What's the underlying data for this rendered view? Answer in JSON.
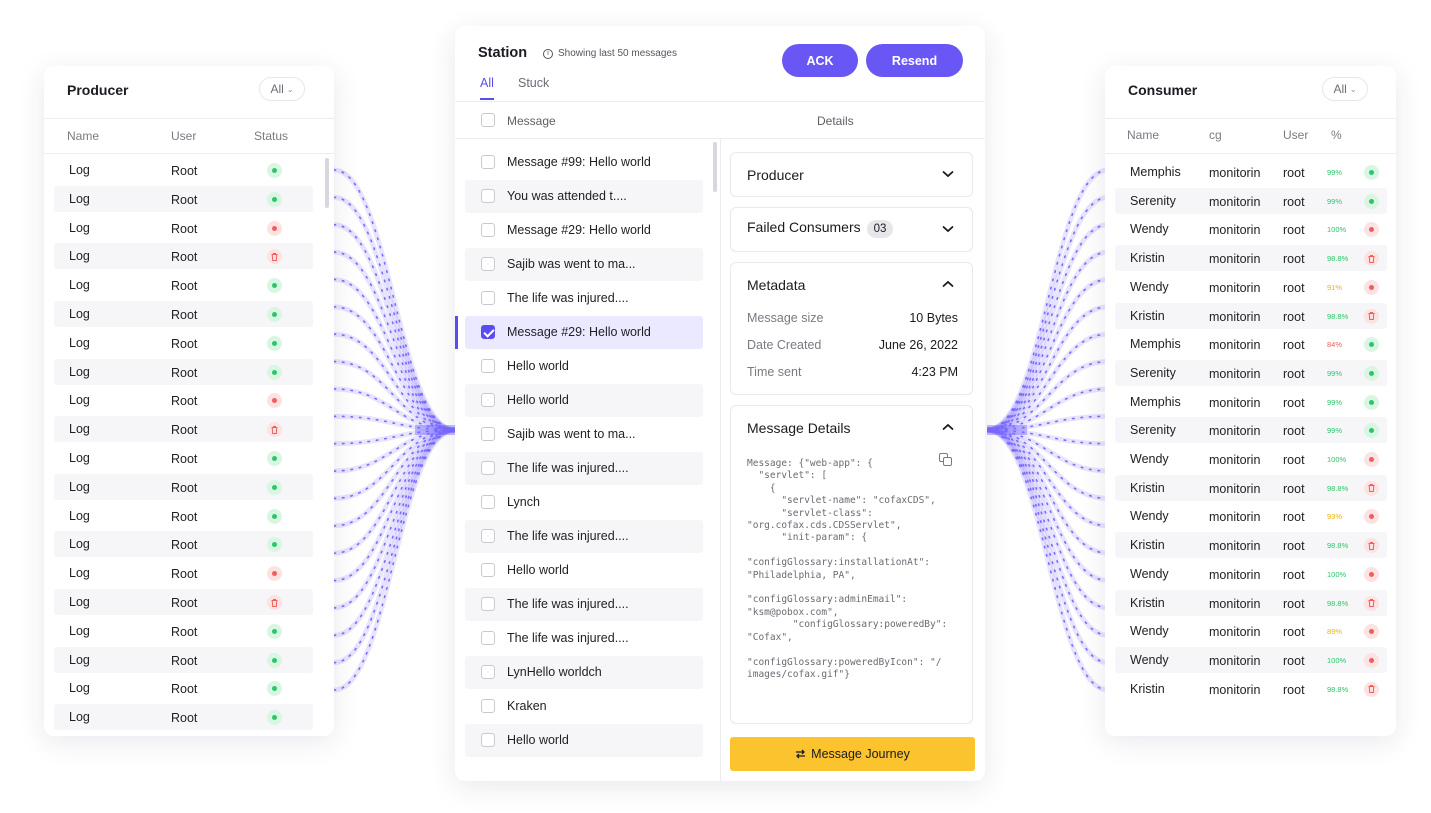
{
  "producer": {
    "title": "Producer",
    "filter": "All",
    "columns": [
      "Name",
      "User",
      "Status"
    ],
    "rows": [
      {
        "name": "Log",
        "user": "Root",
        "status": "ok"
      },
      {
        "name": "Log",
        "user": "Root",
        "status": "ok"
      },
      {
        "name": "Log",
        "user": "Root",
        "status": "error"
      },
      {
        "name": "Log",
        "user": "Root",
        "status": "deleted"
      },
      {
        "name": "Log",
        "user": "Root",
        "status": "ok"
      },
      {
        "name": "Log",
        "user": "Root",
        "status": "ok"
      },
      {
        "name": "Log",
        "user": "Root",
        "status": "ok"
      },
      {
        "name": "Log",
        "user": "Root",
        "status": "ok"
      },
      {
        "name": "Log",
        "user": "Root",
        "status": "error"
      },
      {
        "name": "Log",
        "user": "Root",
        "status": "deleted"
      },
      {
        "name": "Log",
        "user": "Root",
        "status": "ok"
      },
      {
        "name": "Log",
        "user": "Root",
        "status": "ok"
      },
      {
        "name": "Log",
        "user": "Root",
        "status": "ok"
      },
      {
        "name": "Log",
        "user": "Root",
        "status": "ok"
      },
      {
        "name": "Log",
        "user": "Root",
        "status": "error"
      },
      {
        "name": "Log",
        "user": "Root",
        "status": "deleted"
      },
      {
        "name": "Log",
        "user": "Root",
        "status": "ok"
      },
      {
        "name": "Log",
        "user": "Root",
        "status": "ok"
      },
      {
        "name": "Log",
        "user": "Root",
        "status": "ok"
      },
      {
        "name": "Log",
        "user": "Root",
        "status": "ok"
      }
    ]
  },
  "station": {
    "title": "Station",
    "info": "Showing last 50 messages",
    "ack_label": "ACK",
    "resend_label": "Resend",
    "tabs": [
      "All",
      "Stuck"
    ],
    "active_tab": "All",
    "col_message": "Message",
    "col_details": "Details",
    "messages": [
      {
        "text": "Message #99: Hello world",
        "selected": false
      },
      {
        "text": "You was attended t....",
        "selected": false
      },
      {
        "text": "Message #29: Hello world",
        "selected": false
      },
      {
        "text": "Sajib was went to ma...",
        "selected": false
      },
      {
        "text": "The life was injured....",
        "selected": false
      },
      {
        "text": "Message #29: Hello world",
        "selected": true
      },
      {
        "text": "Hello world",
        "selected": false
      },
      {
        "text": "Hello world",
        "selected": false
      },
      {
        "text": "Sajib was went to ma...",
        "selected": false
      },
      {
        "text": "The life was injured....",
        "selected": false
      },
      {
        "text": "Lynch",
        "selected": false
      },
      {
        "text": "The life was injured....",
        "selected": false
      },
      {
        "text": "Hello world",
        "selected": false
      },
      {
        "text": "The life was injured....",
        "selected": false
      },
      {
        "text": "The life was injured....",
        "selected": false
      },
      {
        "text": "LynHello worldch",
        "selected": false
      },
      {
        "text": "Kraken",
        "selected": false
      },
      {
        "text": "Hello world",
        "selected": false
      }
    ],
    "details": {
      "producer_label": "Producer",
      "failed_label": "Failed Consumers",
      "failed_count": "03",
      "metadata_label": "Metadata",
      "metadata": [
        {
          "key": "Message size",
          "value": "10 Bytes"
        },
        {
          "key": "Date Created",
          "value": "June 26, 2022"
        },
        {
          "key": "Time sent",
          "value": "4:23 PM"
        }
      ],
      "message_details_label": "Message Details",
      "code": "Message: {\"web-app\": {\n  \"servlet\": [\n    {\n      \"servlet-name\": \"cofaxCDS\",\n      \"servlet-class\":\n\"org.cofax.cds.CDSServlet\",\n      \"init-param\": {\n\n\"configGlossary:installationAt\":\n\"Philadelphia, PA\",\n\n\"configGlossary:adminEmail\":\n\"ksm@pobox.com\",\n        \"configGlossary:poweredBy\":\n\"Cofax\",\n\n\"configGlossary:poweredByIcon\": \"/\nimages/cofax.gif\"}"
    },
    "journey_label": "Message Journey"
  },
  "consumer": {
    "title": "Consumer",
    "filter": "All",
    "columns": [
      "Name",
      "cg",
      "User",
      "%"
    ],
    "rows": [
      {
        "name": "Memphis",
        "cg": "monitorin",
        "user": "root",
        "pct": "99%",
        "status": "ok"
      },
      {
        "name": "Serenity",
        "cg": "monitorin",
        "user": "root",
        "pct": "99%",
        "status": "ok"
      },
      {
        "name": "Wendy",
        "cg": "monitorin",
        "user": "root",
        "pct": "100%",
        "status": "error"
      },
      {
        "name": "Kristin",
        "cg": "monitorin",
        "user": "root",
        "pct": "98.8%",
        "status": "deleted"
      },
      {
        "name": "Wendy",
        "cg": "monitorin",
        "user": "root",
        "pct": "91%",
        "status": "error"
      },
      {
        "name": "Kristin",
        "cg": "monitorin",
        "user": "root",
        "pct": "98.8%",
        "status": "deleted"
      },
      {
        "name": "Memphis",
        "cg": "monitorin",
        "user": "root",
        "pct": "84%",
        "status": "ok"
      },
      {
        "name": "Serenity",
        "cg": "monitorin",
        "user": "root",
        "pct": "99%",
        "status": "ok"
      },
      {
        "name": "Memphis",
        "cg": "monitorin",
        "user": "root",
        "pct": "99%",
        "status": "ok"
      },
      {
        "name": "Serenity",
        "cg": "monitorin",
        "user": "root",
        "pct": "99%",
        "status": "ok"
      },
      {
        "name": "Wendy",
        "cg": "monitorin",
        "user": "root",
        "pct": "100%",
        "status": "error"
      },
      {
        "name": "Kristin",
        "cg": "monitorin",
        "user": "root",
        "pct": "98.8%",
        "status": "deleted"
      },
      {
        "name": "Wendy",
        "cg": "monitorin",
        "user": "root",
        "pct": "93%",
        "status": "error"
      },
      {
        "name": "Kristin",
        "cg": "monitorin",
        "user": "root",
        "pct": "98.8%",
        "status": "deleted"
      },
      {
        "name": "Wendy",
        "cg": "monitorin",
        "user": "root",
        "pct": "100%",
        "status": "error"
      },
      {
        "name": "Kristin",
        "cg": "monitorin",
        "user": "root",
        "pct": "98.8%",
        "status": "deleted"
      },
      {
        "name": "Wendy",
        "cg": "monitorin",
        "user": "root",
        "pct": "89%",
        "status": "error"
      },
      {
        "name": "Wendy",
        "cg": "monitorin",
        "user": "root",
        "pct": "100%",
        "status": "error"
      },
      {
        "name": "Kristin",
        "cg": "monitorin",
        "user": "root",
        "pct": "98.8%",
        "status": "deleted"
      }
    ]
  },
  "colors": {
    "accent": "#5b4cf0",
    "button": "#6857f5",
    "journey": "#fbc32d",
    "flow": "#7b6cff",
    "ok": "#2bc66a",
    "error": "#f05d5d",
    "warn": "#f0b400"
  },
  "icons": {
    "info": "info-icon",
    "copy": "copy-icon",
    "journey": "route-icon",
    "expand": "chevron-down-icon",
    "collapse": "chevron-up-icon",
    "delete": "trash-icon"
  }
}
